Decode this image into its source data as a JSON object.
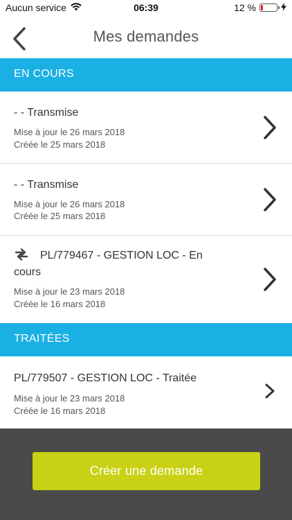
{
  "status_bar": {
    "carrier": "Aucun service",
    "time": "06:39",
    "battery_percent": "12 %",
    "battery_level": 0.12,
    "battery_color": "#e0262a"
  },
  "header": {
    "title": "Mes demandes"
  },
  "sections": {
    "in_progress": {
      "label": "EN COURS"
    },
    "done": {
      "label": "TRAITÉES"
    }
  },
  "requests_in_progress": [
    {
      "title": "- - Transmise",
      "updated": "Mise à jour le 26 mars 2018",
      "created": "Créée le 25 mars 2018"
    },
    {
      "title": "- - Transmise",
      "updated": "Mise à jour le 26 mars 2018",
      "created": "Créée le 25 mars 2018"
    },
    {
      "title_line1": "PL/779467 - GESTION LOC - En",
      "title_line2": "cours",
      "updated": "Mise à jour le 23 mars 2018",
      "created": "Créée le 16 mars 2018",
      "icon": "sync-icon"
    }
  ],
  "requests_done": [
    {
      "title": "PL/779507 - GESTION LOC - Traitée",
      "updated": "Mise à jour le 23 mars 2018",
      "created": "Créée le 16 mars 2018"
    }
  ],
  "footer": {
    "create_label": "Créer une demande"
  },
  "colors": {
    "accent": "#1ab0e3",
    "button": "#c8d114",
    "footer_bg": "#4a4a4a"
  }
}
